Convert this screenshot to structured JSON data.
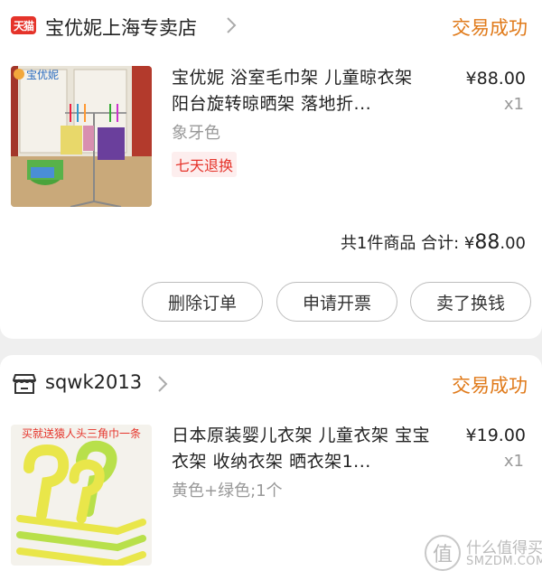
{
  "orders": [
    {
      "store_badge": "天猫",
      "store_name": "宝优妮上海专卖店",
      "status": "交易成功",
      "thumb_logo": "宝优妮",
      "title": "宝优妮 浴室毛巾架 儿童晾衣架 阳台旋转晾晒架 落地折...",
      "price": "¥88.00",
      "qty": "x1",
      "sku": "象牙色",
      "tag": "七天退换",
      "total_label": "共1件商品 合计: ",
      "total_currency": "¥",
      "total_int": "88",
      "total_dec": ".00",
      "buttons": [
        "删除订单",
        "申请开票",
        "卖了换钱"
      ]
    },
    {
      "store_name": "sqwk2013",
      "status": "交易成功",
      "thumb_banner": "买就送猿人头三角巾一条",
      "title": "日本原装婴儿衣架 儿童衣架 宝宝衣架 收纳衣架 晒衣架1...",
      "price": "¥19.00",
      "qty": "x1",
      "sku": "黄色+绿色;1个"
    }
  ],
  "watermark": {
    "cn": "什么值得买",
    "en": "SMZDM.COM",
    "glyph": "值"
  },
  "colors": {
    "accent": "#e07a1a",
    "tmall": "#e5332a",
    "muted": "#999999"
  },
  "icons": {
    "store": "store-icon",
    "chevron": "chevron-right-icon"
  }
}
